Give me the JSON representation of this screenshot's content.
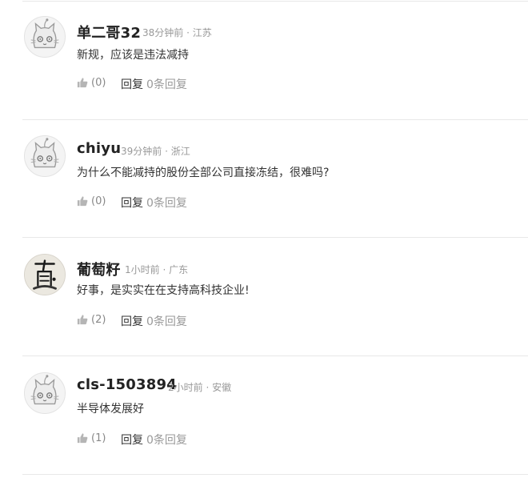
{
  "comments": [
    {
      "username": "单二哥32",
      "meta": "38分钟前 · 江苏",
      "text": "新规，应该是违法减持",
      "likes": "(0)",
      "reply_label": "回复",
      "reply_count": "0条回复",
      "avatar": "cat-avatar-icon"
    },
    {
      "username": "chiyu",
      "meta": "39分钟前 · 浙江",
      "text": "为什么不能减持的股份全部公司直接冻结，很难吗?",
      "likes": "(0)",
      "reply_label": "回复",
      "reply_count": "0条回复",
      "avatar": "cat-avatar-icon"
    },
    {
      "username": "葡萄籽",
      "meta": "1小时前 · 广东",
      "text": "好事，是实实在在支持高科技企业!",
      "likes": "(2)",
      "reply_label": "回复",
      "reply_count": "0条回复",
      "avatar": "calligraphy-avatar-icon"
    },
    {
      "username": "cls-1503894",
      "meta": "2小时前 · 安徽",
      "text": "半导体发展好",
      "likes": "(1)",
      "reply_label": "回复",
      "reply_count": "0条回复",
      "avatar": "cat-avatar-icon"
    }
  ],
  "like_icon": "thumbs-up-icon",
  "colors": {
    "username": "#222222",
    "meta": "#999999",
    "text": "#333333",
    "divider": "#e8e8e8"
  }
}
